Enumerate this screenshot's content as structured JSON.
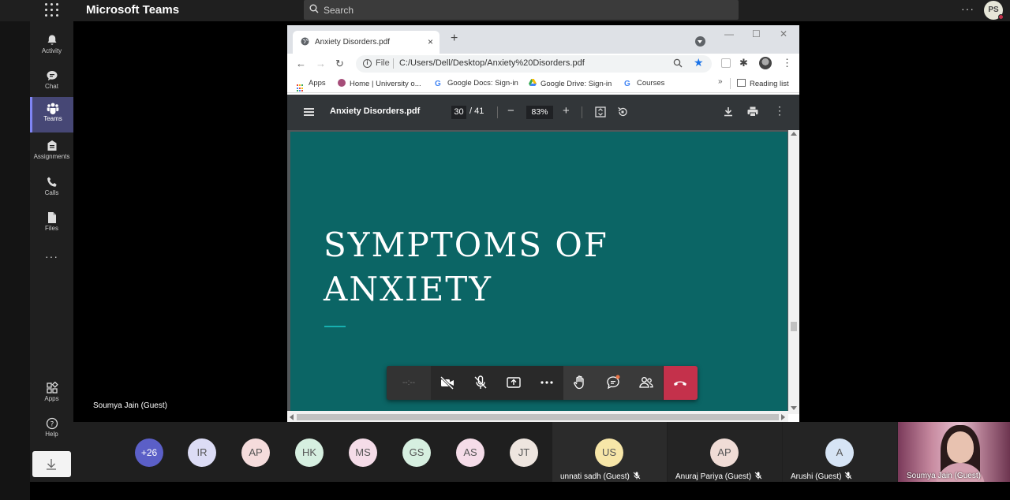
{
  "teams": {
    "app_title": "Microsoft Teams",
    "search_placeholder": "Search",
    "profile_initials": "PS",
    "nav": {
      "activity": "Activity",
      "chat": "Chat",
      "teams": "Teams",
      "assignments": "Assignments",
      "calls": "Calls",
      "files": "Files",
      "more": "···",
      "apps": "Apps",
      "help": "Help"
    }
  },
  "browser": {
    "tab_title": "Anxiety Disorders.pdf",
    "tab_close": "×",
    "new_tab": "+",
    "omnibox_scheme": "File",
    "url": "C:/Users/Dell/Desktop/Anxiety%20Disorders.pdf",
    "bookmarks": [
      "Apps",
      "Home | University o...",
      "Google Docs: Sign-in",
      "Google Drive: Sign-in",
      "Courses"
    ],
    "bookmarks_more": "»",
    "reading_list": "Reading list"
  },
  "pdf": {
    "title": "Anxiety Disorders.pdf",
    "current_page": "30",
    "total_pages": "/ 41",
    "zoom": "83%",
    "zoom_out": "−",
    "zoom_in": "+",
    "slide_title_line1": "SYMPTOMS OF",
    "slide_title_line2": "ANXIETY"
  },
  "call": {
    "timer": "--:--",
    "presenter_label": "Soumya Jain (Guest)",
    "overflow_count": "+26",
    "participants": [
      {
        "initials": "IR",
        "color": "#dcdcf5"
      },
      {
        "initials": "AP",
        "color": "#f5dcdc"
      },
      {
        "initials": "HK",
        "color": "#d6efe0"
      },
      {
        "initials": "MS",
        "color": "#f5dce8"
      },
      {
        "initials": "GS",
        "color": "#d6efe0"
      },
      {
        "initials": "AS",
        "color": "#f5dce8"
      },
      {
        "initials": "JT",
        "color": "#eee5df"
      }
    ],
    "tiles": [
      {
        "initials": "US",
        "name": "unnati sadh (Guest)",
        "color": "#f7e6a8"
      },
      {
        "initials": "AP",
        "name": "Anuraj Pariya (Guest)",
        "color": "#f0dcd6"
      },
      {
        "initials": "A",
        "name": "Arushi (Guest)",
        "color": "#d6e4f5"
      }
    ],
    "video_tile_name": "Soumya Jain (Guest)"
  }
}
